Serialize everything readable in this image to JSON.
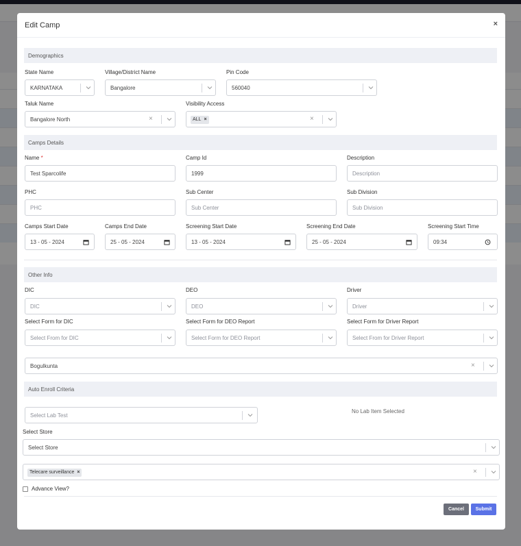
{
  "modal": {
    "title": "Edit Camp",
    "close_symbol": "×"
  },
  "sections": {
    "demographics": "Demographics",
    "camps_details": "Camps Details",
    "other_info": "Other Info",
    "auto_enroll": "Auto Enroll Criteria"
  },
  "demographics": {
    "state_label": "State Name",
    "state_value": "KARNATAKA",
    "village_label": "Village/District Name",
    "village_value": "Bangalore",
    "pin_label": "Pin Code",
    "pin_value": "560040",
    "taluk_label": "Taluk Name",
    "taluk_value": "Bangalore North",
    "visibility_label": "Visibility Access",
    "visibility_tag": "ALL"
  },
  "camp": {
    "name_label": "Name",
    "name_value": "Test Sparcolife",
    "required_mark": "*",
    "id_label": "Camp Id",
    "id_value": "1999",
    "desc_label": "Description",
    "desc_placeholder": "Description",
    "phc_label": "PHC",
    "phc_placeholder": "PHC",
    "subcenter_label": "Sub Center",
    "subcenter_placeholder": "Sub Center",
    "subdivision_label": "Sub Division",
    "subdivision_placeholder": "Sub Division",
    "start_date_label": "Camps Start Date",
    "start_date_value": "13 - 05 - 2024",
    "end_date_label": "Camps End Date",
    "end_date_value": "25 - 05 - 2024",
    "screen_start_label": "Screening Start Date",
    "screen_start_value": "13 - 05 - 2024",
    "screen_end_label": "Screening End Date",
    "screen_end_value": "25 - 05 - 2024",
    "screen_time_label": "Screening Start Time",
    "screen_time_value": "09:34"
  },
  "other": {
    "dic_label": "DIC",
    "dic_value": "DIC",
    "deo_label": "DEO",
    "deo_value": "DEO",
    "driver_label": "Driver",
    "driver_value": "Driver",
    "form_dic_label": "Select Form for DIC",
    "form_dic_placeholder": "Select From for DIC",
    "form_deo_label": "Select Form for DEO Report",
    "form_deo_placeholder": "Select Form for DEO Report",
    "form_driver_label": "Select Form for Driver Report",
    "form_driver_placeholder": "Select From for Driver Report",
    "location_value": "Bogulkunta"
  },
  "auto_enroll": {
    "lab_test_placeholder": "Select Lab Test",
    "no_lab_text": "No Lab Item Selected",
    "store_label": "Select Store",
    "store_placeholder": "Select Store",
    "tag": "Telecare surveillance",
    "advance_view": "Advance View?"
  },
  "buttons": {
    "cancel": "Cancel",
    "submit": "Submit"
  },
  "colors": {
    "submit": "#5a72e6",
    "cancel": "#6c6f7a",
    "section_bg": "#eef0f5"
  }
}
